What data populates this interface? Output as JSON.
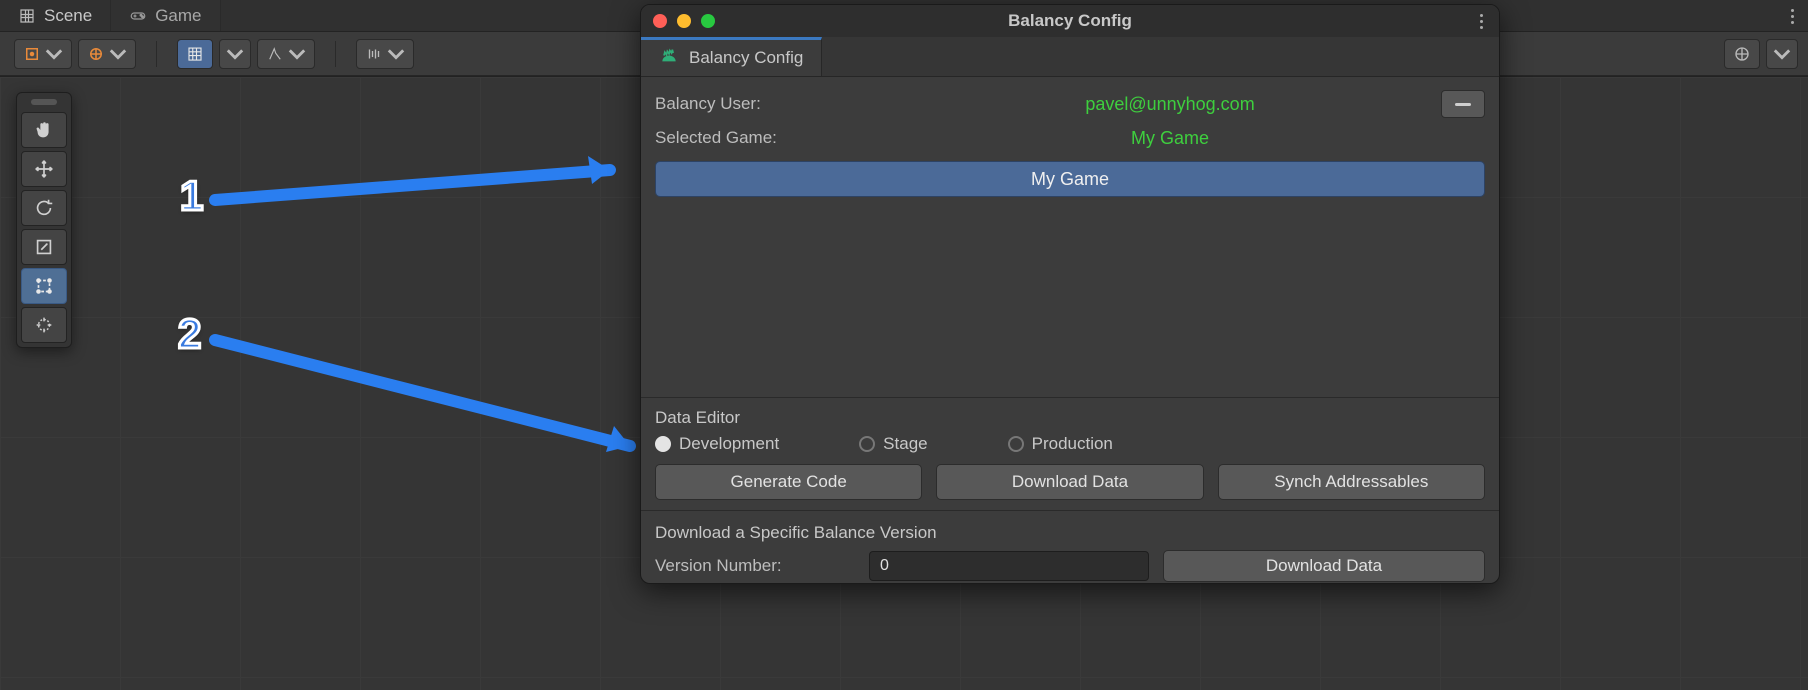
{
  "top_tabs": {
    "scene": "Scene",
    "game": "Game"
  },
  "popup": {
    "window_title": "Balancy Config",
    "tab_label": "Balancy Config",
    "user_label": "Balancy User:",
    "user_value": "pavel@unnyhog.com",
    "selected_game_label": "Selected Game:",
    "selected_game_value": "My Game",
    "game_button": "My Game",
    "data_editor_label": "Data Editor",
    "env": {
      "dev": "Development",
      "stage": "Stage",
      "prod": "Production",
      "selected": "dev"
    },
    "buttons": {
      "generate": "Generate Code",
      "download": "Download Data",
      "sync": "Synch Addressables"
    },
    "specific": {
      "title": "Download a Specific Balance Version",
      "version_label": "Version Number:",
      "version_value": "0",
      "download": "Download Data"
    }
  },
  "annotations": {
    "a1": "1",
    "a2": "2"
  }
}
